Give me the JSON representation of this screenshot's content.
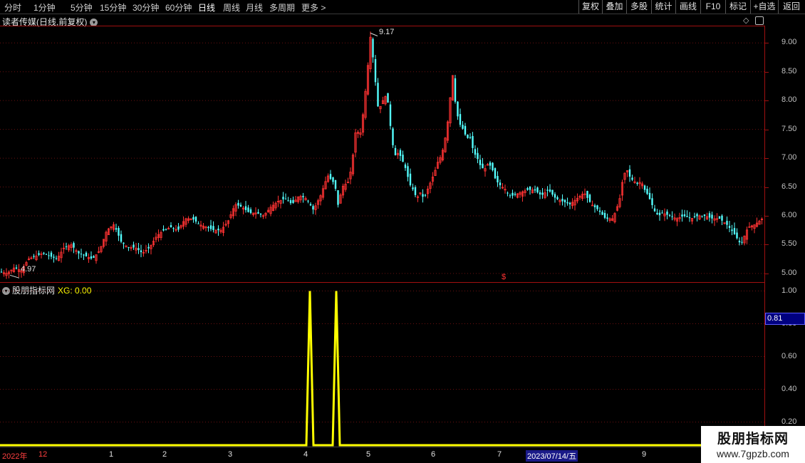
{
  "toolbar": {
    "periods": [
      "分时",
      "1分钟",
      "5分钟",
      "15分钟",
      "30分钟",
      "60分钟",
      "日线",
      "周线",
      "月线",
      "多周期",
      "更多 >"
    ],
    "active_period": "日线",
    "tools": [
      "复权",
      "叠加",
      "多股",
      "统计",
      "画线",
      "F10",
      "标记",
      "+自选",
      "返回"
    ]
  },
  "main_chart": {
    "title": "读者传媒(日线,前复权)",
    "high_label": "9.17",
    "low_label": "4.97",
    "marker_symbol": "$",
    "y_ticks": [
      "9.00",
      "8.50",
      "8.00",
      "7.50",
      "7.00",
      "6.50",
      "6.00",
      "5.50",
      "5.00"
    ],
    "up_color": "#ff3232",
    "down_color": "#54ffff"
  },
  "indicator": {
    "name": "股朋指标网",
    "xg_label": "XG: 0.00",
    "readout": "0.81",
    "y_ticks": [
      "1.00",
      "0.80",
      "0.60",
      "0.40",
      "0.20"
    ],
    "line_color": "#ffff00"
  },
  "x_axis": {
    "labels": [
      {
        "text": "2022年",
        "color": "red"
      },
      {
        "text": "12",
        "color": "red"
      },
      {
        "text": "1",
        "color": "normal"
      },
      {
        "text": "2",
        "color": "normal"
      },
      {
        "text": "3",
        "color": "normal"
      },
      {
        "text": "4",
        "color": "normal"
      },
      {
        "text": "5",
        "color": "normal"
      },
      {
        "text": "6",
        "color": "normal"
      },
      {
        "text": "7",
        "color": "normal"
      },
      {
        "text": "2023/07/14/五",
        "color": "selected"
      },
      {
        "text": "9",
        "color": "normal"
      }
    ]
  },
  "watermark": {
    "line1": "股朋指标网",
    "line2": "www.7gpzb.com"
  },
  "chart_data": [
    {
      "type": "candlestick",
      "title": "读者传媒(日线,前复权)",
      "ylim": [
        4.85,
        9.3
      ],
      "y_ticks": [
        5.0,
        5.5,
        6.0,
        6.5,
        7.0,
        7.5,
        8.0,
        8.5,
        9.0
      ],
      "high": 9.17,
      "low": 4.97,
      "close_path": [
        [
          0,
          5.03
        ],
        [
          10,
          5.0
        ],
        [
          20,
          5.1
        ],
        [
          30,
          5.05
        ],
        [
          40,
          5.25
        ],
        [
          50,
          5.3
        ],
        [
          60,
          5.35
        ],
        [
          70,
          5.3
        ],
        [
          80,
          5.25
        ],
        [
          90,
          5.45
        ],
        [
          100,
          5.5
        ],
        [
          110,
          5.35
        ],
        [
          120,
          5.3
        ],
        [
          130,
          5.25
        ],
        [
          140,
          5.4
        ],
        [
          150,
          5.75
        ],
        [
          160,
          5.85
        ],
        [
          170,
          5.55
        ],
        [
          180,
          5.45
        ],
        [
          190,
          5.45
        ],
        [
          200,
          5.35
        ],
        [
          210,
          5.45
        ],
        [
          220,
          5.65
        ],
        [
          230,
          5.75
        ],
        [
          240,
          5.8
        ],
        [
          250,
          5.75
        ],
        [
          260,
          5.95
        ],
        [
          270,
          5.95
        ],
        [
          280,
          5.85
        ],
        [
          290,
          5.8
        ],
        [
          300,
          5.75
        ],
        [
          310,
          5.75
        ],
        [
          320,
          5.9
        ],
        [
          330,
          6.2
        ],
        [
          340,
          6.15
        ],
        [
          350,
          6.05
        ],
        [
          360,
          6.05
        ],
        [
          370,
          6.0
        ],
        [
          380,
          6.15
        ],
        [
          390,
          6.25
        ],
        [
          400,
          6.3
        ],
        [
          410,
          6.2
        ],
        [
          420,
          6.35
        ],
        [
          430,
          6.3
        ],
        [
          440,
          6.1
        ],
        [
          450,
          6.35
        ],
        [
          460,
          6.7
        ],
        [
          470,
          6.55
        ],
        [
          475,
          6.15
        ],
        [
          480,
          6.5
        ],
        [
          490,
          6.6
        ],
        [
          495,
          7.0
        ],
        [
          500,
          7.55
        ],
        [
          505,
          7.35
        ],
        [
          510,
          7.8
        ],
        [
          515,
          8.4
        ],
        [
          520,
          9.1
        ],
        [
          525,
          8.6
        ],
        [
          530,
          7.9
        ],
        [
          535,
          7.9
        ],
        [
          540,
          8.1
        ],
        [
          545,
          7.95
        ],
        [
          550,
          7.3
        ],
        [
          555,
          7.05
        ],
        [
          560,
          7.1
        ],
        [
          565,
          6.95
        ],
        [
          570,
          6.8
        ],
        [
          575,
          6.55
        ],
        [
          580,
          6.45
        ],
        [
          585,
          6.3
        ],
        [
          590,
          6.4
        ],
        [
          595,
          6.3
        ],
        [
          600,
          6.45
        ],
        [
          605,
          6.6
        ],
        [
          610,
          6.75
        ],
        [
          615,
          6.95
        ],
        [
          620,
          7.05
        ],
        [
          625,
          7.35
        ],
        [
          630,
          7.75
        ],
        [
          635,
          8.5
        ],
        [
          640,
          7.85
        ],
        [
          645,
          7.6
        ],
        [
          650,
          7.5
        ],
        [
          655,
          7.35
        ],
        [
          660,
          7.35
        ],
        [
          665,
          7.1
        ],
        [
          670,
          7.0
        ],
        [
          675,
          6.85
        ],
        [
          680,
          6.8
        ],
        [
          685,
          6.9
        ],
        [
          690,
          6.85
        ],
        [
          695,
          6.65
        ],
        [
          700,
          6.55
        ],
        [
          705,
          6.5
        ],
        [
          710,
          6.45
        ],
        [
          715,
          6.35
        ],
        [
          720,
          6.35
        ],
        [
          730,
          6.4
        ],
        [
          740,
          6.45
        ],
        [
          750,
          6.45
        ],
        [
          760,
          6.35
        ],
        [
          770,
          6.45
        ],
        [
          780,
          6.3
        ],
        [
          790,
          6.25
        ],
        [
          800,
          6.2
        ],
        [
          810,
          6.3
        ],
        [
          820,
          6.4
        ],
        [
          830,
          6.2
        ],
        [
          840,
          6.1
        ],
        [
          850,
          5.95
        ],
        [
          860,
          5.95
        ],
        [
          865,
          6.1
        ],
        [
          870,
          6.3
        ],
        [
          875,
          6.7
        ],
        [
          880,
          6.8
        ],
        [
          885,
          6.65
        ],
        [
          890,
          6.6
        ],
        [
          895,
          6.55
        ],
        [
          900,
          6.6
        ],
        [
          905,
          6.45
        ],
        [
          910,
          6.35
        ],
        [
          915,
          6.2
        ],
        [
          920,
          6.05
        ],
        [
          925,
          6.0
        ],
        [
          930,
          6.05
        ],
        [
          940,
          6.0
        ],
        [
          950,
          5.95
        ],
        [
          960,
          6.0
        ],
        [
          970,
          5.95
        ],
        [
          980,
          6.0
        ],
        [
          990,
          6.0
        ],
        [
          1000,
          5.95
        ],
        [
          1010,
          5.95
        ],
        [
          1020,
          5.85
        ],
        [
          1030,
          5.7
        ],
        [
          1040,
          5.5
        ],
        [
          1045,
          5.65
        ],
        [
          1050,
          5.8
        ],
        [
          1060,
          5.85
        ],
        [
          1070,
          5.95
        ]
      ]
    },
    {
      "type": "line",
      "series": [
        {
          "name": "XG",
          "values": [
            0,
            0,
            0,
            1,
            0,
            0,
            1,
            0,
            0,
            0
          ]
        }
      ],
      "ylim": [
        0.05,
        1.05
      ],
      "y_ticks": [
        0.2,
        0.4,
        0.6,
        0.8,
        1.0
      ],
      "spikes": [
        {
          "value": 1.0
        },
        {
          "value": 1.0
        }
      ],
      "readout": 0.81
    }
  ]
}
